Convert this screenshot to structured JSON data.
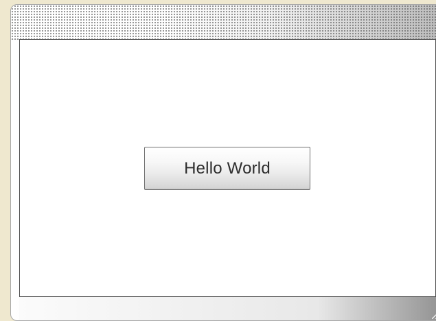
{
  "window": {
    "button_label": "Hello World"
  },
  "colors": {
    "background": "#efe8cf",
    "client_area": "#ffffff",
    "button_text": "#2d2d2d"
  }
}
